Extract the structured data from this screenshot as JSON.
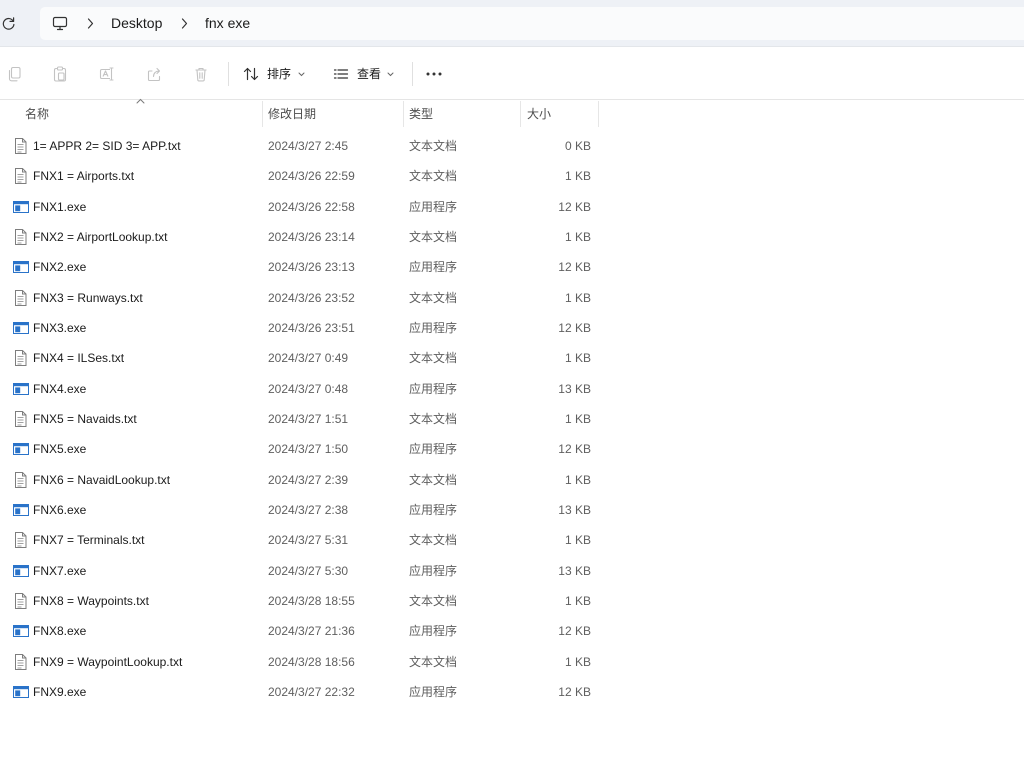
{
  "colors": {
    "topbar_bg": "#eef1f6",
    "address_bg": "#fafbfc",
    "text": "#1b1b1b",
    "muted_text": "#5f5f5f",
    "header_text": "#4d4d4d",
    "disabled_icon": "#c3c3c3",
    "app_icon_blue": "#2a73c9"
  },
  "address_bar": {
    "refresh_icon": "refresh-icon",
    "location_icon": "monitor-icon",
    "separator_icon": "chevron-right-icon",
    "breadcrumb": [
      "Desktop",
      "fnx exe"
    ]
  },
  "toolbar": {
    "actions": [
      "copy-icon",
      "paste-icon",
      "rename-icon",
      "share-icon",
      "delete-icon"
    ],
    "sort": {
      "icon": "sort-icon",
      "label": "排序",
      "dropdown_icon": "chevron-down-icon"
    },
    "view": {
      "icon": "view-list-icon",
      "label": "查看",
      "dropdown_icon": "chevron-down-icon"
    },
    "more_icon": "more-icon"
  },
  "columns": {
    "name": "名称",
    "modified": "修改日期",
    "type": "类型",
    "size": "大小",
    "sort_indicator_icon": "chevron-up-icon"
  },
  "files": [
    {
      "icon": "text-file-icon",
      "name": "1= APPR 2= SID 3= APP.txt",
      "modified": "2024/3/27 2:45",
      "type": "文本文档",
      "size": "0 KB"
    },
    {
      "icon": "text-file-icon",
      "name": "FNX1 = Airports.txt",
      "modified": "2024/3/26 22:59",
      "type": "文本文档",
      "size": "1 KB"
    },
    {
      "icon": "application-icon",
      "name": "FNX1.exe",
      "modified": "2024/3/26 22:58",
      "type": "应用程序",
      "size": "12 KB"
    },
    {
      "icon": "text-file-icon",
      "name": "FNX2 = AirportLookup.txt",
      "modified": "2024/3/26 23:14",
      "type": "文本文档",
      "size": "1 KB"
    },
    {
      "icon": "application-icon",
      "name": "FNX2.exe",
      "modified": "2024/3/26 23:13",
      "type": "应用程序",
      "size": "12 KB"
    },
    {
      "icon": "text-file-icon",
      "name": "FNX3 = Runways.txt",
      "modified": "2024/3/26 23:52",
      "type": "文本文档",
      "size": "1 KB"
    },
    {
      "icon": "application-icon",
      "name": "FNX3.exe",
      "modified": "2024/3/26 23:51",
      "type": "应用程序",
      "size": "12 KB"
    },
    {
      "icon": "text-file-icon",
      "name": "FNX4 = ILSes.txt",
      "modified": "2024/3/27 0:49",
      "type": "文本文档",
      "size": "1 KB"
    },
    {
      "icon": "application-icon",
      "name": "FNX4.exe",
      "modified": "2024/3/27 0:48",
      "type": "应用程序",
      "size": "13 KB"
    },
    {
      "icon": "text-file-icon",
      "name": "FNX5 = Navaids.txt",
      "modified": "2024/3/27 1:51",
      "type": "文本文档",
      "size": "1 KB"
    },
    {
      "icon": "application-icon",
      "name": "FNX5.exe",
      "modified": "2024/3/27 1:50",
      "type": "应用程序",
      "size": "12 KB"
    },
    {
      "icon": "text-file-icon",
      "name": "FNX6 = NavaidLookup.txt",
      "modified": "2024/3/27 2:39",
      "type": "文本文档",
      "size": "1 KB"
    },
    {
      "icon": "application-icon",
      "name": "FNX6.exe",
      "modified": "2024/3/27 2:38",
      "type": "应用程序",
      "size": "13 KB"
    },
    {
      "icon": "text-file-icon",
      "name": "FNX7 = Terminals.txt",
      "modified": "2024/3/27 5:31",
      "type": "文本文档",
      "size": "1 KB"
    },
    {
      "icon": "application-icon",
      "name": "FNX7.exe",
      "modified": "2024/3/27 5:30",
      "type": "应用程序",
      "size": "13 KB"
    },
    {
      "icon": "text-file-icon",
      "name": "FNX8 = Waypoints.txt",
      "modified": "2024/3/28 18:55",
      "type": "文本文档",
      "size": "1 KB"
    },
    {
      "icon": "application-icon",
      "name": "FNX8.exe",
      "modified": "2024/3/27 21:36",
      "type": "应用程序",
      "size": "12 KB"
    },
    {
      "icon": "text-file-icon",
      "name": "FNX9 = WaypointLookup.txt",
      "modified": "2024/3/28 18:56",
      "type": "文本文档",
      "size": "1 KB"
    },
    {
      "icon": "application-icon",
      "name": "FNX9.exe",
      "modified": "2024/3/27 22:32",
      "type": "应用程序",
      "size": "12 KB"
    }
  ]
}
